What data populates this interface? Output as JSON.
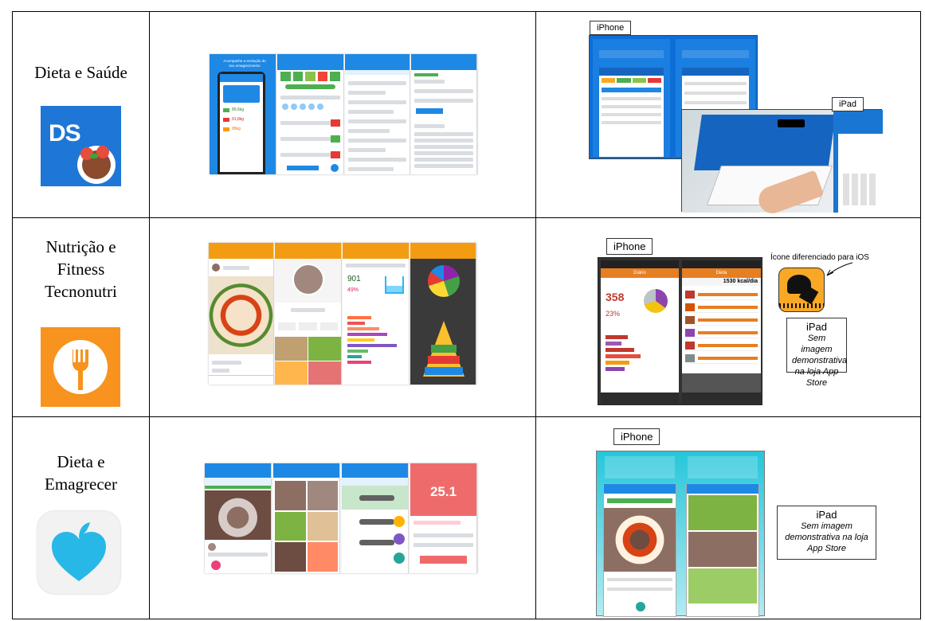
{
  "rows": [
    {
      "app_name": "Dieta e Saúde",
      "icon": {
        "name": "ds-logo-icon",
        "text": "DS",
        "color": "#1e77d6"
      },
      "ios_labels": {
        "iphone": "iPhone",
        "ipad": "iPad"
      },
      "android_captions": {
        "p1": "Acompanhe a evolução do seu emagrecimento",
        "weights": [
          "89,6kg",
          "91,8kg",
          "95kg"
        ]
      }
    },
    {
      "app_name": "Nutrição e\nFitness\nTecnonutri",
      "icon": {
        "name": "fork-icon",
        "color": "#f7931e"
      },
      "ios_labels": {
        "iphone": "iPhone",
        "icon_note": "Ícone diferenciado para iOS"
      },
      "ios_screen_titles": [
        "Diário",
        "Dieta"
      ],
      "ipad_note": {
        "title": "iPad",
        "body": "Sem imagem demonstrativa na loja App Store"
      },
      "ios_values": {
        "kcal": "358",
        "pct": "23%",
        "daily": "1530 kcal/dia"
      }
    },
    {
      "app_name": "Dieta e\nEmagrecer",
      "icon": {
        "name": "heart-apple-icon",
        "color": "#27b8e8"
      },
      "ios_labels": {
        "iphone": "iPhone"
      },
      "ipad_note": {
        "title": "iPad",
        "body": "Sem imagem demonstrativa na loja App Store"
      },
      "android_values": {
        "imc": "25.1"
      }
    }
  ],
  "colors": {
    "ds_blue": "#1e88e5",
    "tecno_orange": "#f39c12",
    "dieta_blue": "#2196f3",
    "dieta_coral": "#ef6b6b"
  }
}
